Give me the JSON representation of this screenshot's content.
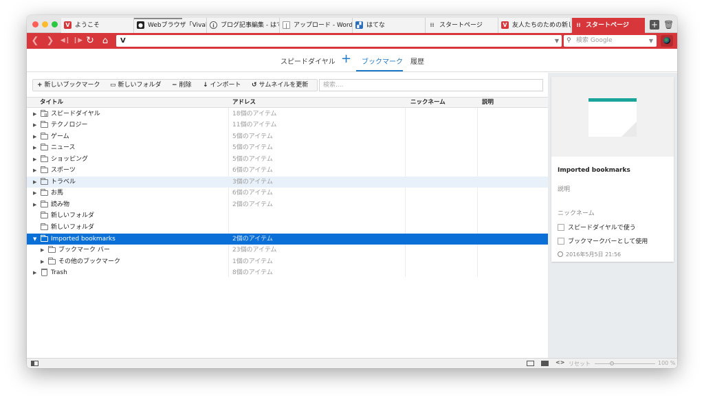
{
  "tabs": [
    {
      "label": "ようこそ",
      "icon": "vivaldi-icon",
      "color": "#d7373a"
    },
    {
      "label": "Webブラウザ「Vivaldi」",
      "icon": "github-cat-icon",
      "color": "#222222"
    },
    {
      "label": "ブログ記事編集 - はて",
      "icon": "info-icon",
      "color": "#555555"
    },
    {
      "label": "アップロード - WordW",
      "icon": "document-icon",
      "color": "#777777"
    },
    {
      "label": "はてな",
      "icon": "hatena-icon",
      "color": "#2a6ebb"
    },
    {
      "label": "スタートページ",
      "icon": "grid-icon",
      "color": "#555555"
    },
    {
      "label": "友人たちのための新し",
      "icon": "vivaldi-icon",
      "color": "#d7373a"
    },
    {
      "label": "スタートページ",
      "icon": "grid-icon",
      "color": "#ffffff",
      "active": true
    }
  ],
  "address": {
    "url": "V",
    "search_placeholder": "検索 Google"
  },
  "panel_tabs": {
    "speed_dial": "スピードダイヤル",
    "plus": "+",
    "bookmarks": "ブックマーク",
    "history": "履歴"
  },
  "toolbar": {
    "new_bookmark": "新しいブックマーク",
    "new_folder": "新しいフォルダ",
    "delete": "削除",
    "import": "インポート",
    "refresh_thumbnails": "サムネイルを更新",
    "filter_placeholder": "検索...."
  },
  "columns": {
    "title": "タイトル",
    "address": "アドレス",
    "nickname": "ニックネーム",
    "description": "説明"
  },
  "rows": [
    {
      "title": "スピードダイヤル",
      "items": "18個のアイテム"
    },
    {
      "title": "テクノロジー",
      "items": "11個のアイテム"
    },
    {
      "title": "ゲーム",
      "items": "5個のアイテム"
    },
    {
      "title": "ニュース",
      "items": "5個のアイテム"
    },
    {
      "title": "ショッピング",
      "items": "5個のアイテム"
    },
    {
      "title": "スポーツ",
      "items": "6個のアイテム"
    },
    {
      "title": "トラベル",
      "items": "3個のアイテム"
    },
    {
      "title": "お馬",
      "items": "6個のアイテム"
    },
    {
      "title": "読み物",
      "items": "2個のアイテム"
    },
    {
      "title": "新しいフォルダ",
      "items": ""
    },
    {
      "title": "新しいフォルダ",
      "items": ""
    },
    {
      "title": "Imported bookmarks",
      "items": "2個のアイテム"
    },
    {
      "title": "ブックマーク バー",
      "items": "23個のアイテム"
    },
    {
      "title": "その他のブックマーク",
      "items": "1個のアイテム"
    },
    {
      "title": "Trash",
      "items": "8個のアイテム"
    }
  ],
  "info": {
    "title": "Imported bookmarks",
    "description_label": "説明",
    "nickname_label": "ニックネーム",
    "use_speed_dial": "スピードダイヤルで使う",
    "use_bookmark_bar": "ブックマークバーとして使用",
    "date": "2016年5月5日 21:56",
    "accent_color": "#1aa49a"
  },
  "status": {
    "reset_label": "リセット",
    "zoom": "100 %"
  },
  "colors": {
    "brand": "#d7373a",
    "selection": "#0a6fd6",
    "link": "#1d79c9"
  }
}
